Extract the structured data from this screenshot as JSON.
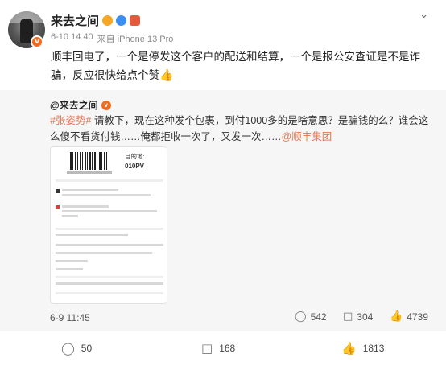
{
  "user": {
    "name": "来去之间",
    "verified_badge": "v",
    "meta": {
      "time": "6-10 14:40",
      "source": "来自 iPhone 13 Pro"
    }
  },
  "post_text": "顺丰回电了，一个是停发这个客户的配送和结算，一个是报公安查证是不是诈骗，反应很快给点个赞",
  "post_text_emoji": "👍",
  "repost": {
    "author": "@来去之间",
    "verified_badge": "v",
    "hashtag": "#张姿势#",
    "text": " 请教下，现在这种发个包裹，到付1000多的是啥意思？是骗钱的么？谁会这么傻不看货付钱……俺都拒收一次了，又发一次……",
    "mention": "@顺丰集团",
    "receipt": {
      "dest_label": "目的地:",
      "dest_code": "010PV"
    },
    "time": "6-9 11:45",
    "actions": {
      "repost_count": "542",
      "comment_count": "304",
      "like_count": "4739"
    }
  },
  "actions": {
    "repost_count": "50",
    "comment_count": "168",
    "like_count": "1813"
  },
  "icons": {
    "menu": "chevron-down-icon",
    "repost": "share-icon",
    "comment": "comment-icon",
    "like": "thumbs-up-icon"
  },
  "colors": {
    "accent": "#eb7350",
    "badge": "#f26a1b"
  }
}
